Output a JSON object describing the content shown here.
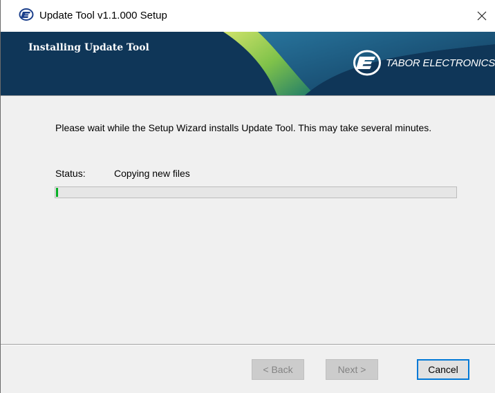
{
  "window": {
    "title": "Update Tool v1.1.000 Setup",
    "app_icon": "tabor-e-icon",
    "close_icon": "close-icon"
  },
  "banner": {
    "title": "Installing Update Tool",
    "brand": "TABOR ELECTRONICS",
    "logo_icon": "tabor-electronics-logo"
  },
  "content": {
    "message": "Please wait while the Setup Wizard installs Update Tool.  This may take several minutes.",
    "status_label": "Status:",
    "status_value": "Copying new files",
    "progress_fraction": 0.005
  },
  "buttons": {
    "back": "< Back",
    "next": "Next >",
    "cancel": "Cancel"
  },
  "colors": {
    "banner_bg": "#0f3658",
    "progress_fill": "#06b025",
    "focus_border": "#0078d7"
  }
}
